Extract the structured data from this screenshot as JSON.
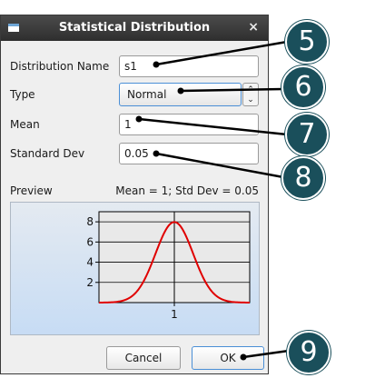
{
  "dialog": {
    "title": "Statistical Distribution",
    "close_glyph": "×",
    "icon": "app-window-icon"
  },
  "form": {
    "distribution_name_label": "Distribution Name",
    "distribution_name_value": "s1",
    "type_label": "Type",
    "type_value": "Normal",
    "mean_label": "Mean",
    "mean_value": "1",
    "std_dev_label": "Standard Dev",
    "std_dev_value": "0.05"
  },
  "preview": {
    "label": "Preview",
    "caption": "Mean = 1; Std Dev = 0.05"
  },
  "buttons": {
    "cancel": "Cancel",
    "ok": "OK"
  },
  "callouts": [
    "5",
    "6",
    "7",
    "8",
    "9"
  ],
  "colors": {
    "callout": "#1a4f5b",
    "curve": "#e00000",
    "focus": "#4a8fd6"
  },
  "chart_data": {
    "type": "line",
    "series": [
      {
        "values": "normal pdf, mean 1, std dev 0.05"
      }
    ],
    "yticks": [
      "2",
      "4",
      "6",
      "8"
    ],
    "xticks": [
      "1"
    ],
    "ylim": [
      0,
      9
    ],
    "xlim": [
      0.8,
      1.2
    ],
    "mean": 1,
    "std": 0.05,
    "grid": true
  }
}
